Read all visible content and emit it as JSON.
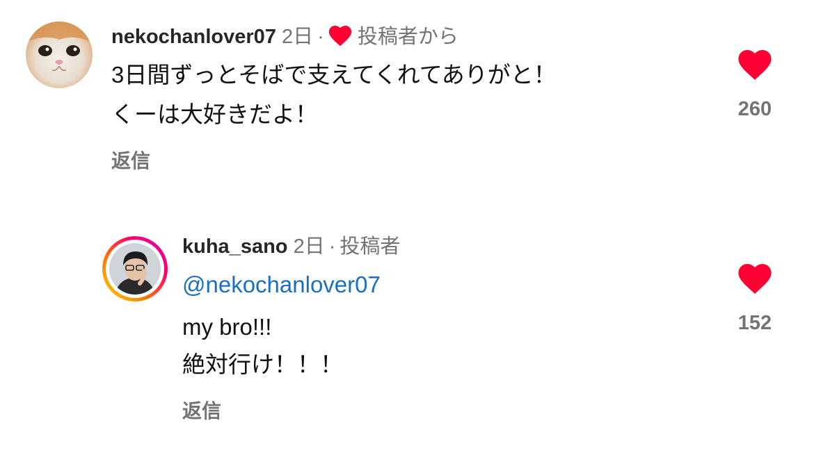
{
  "comments": [
    {
      "username": "nekochanlover07",
      "time": "2日",
      "separator": "·",
      "badge": "投稿者から",
      "badge_heart_icon": "heart-icon",
      "lines": [
        "3日間ずっとそばで支えてくれてありがと！",
        "くーは大好きだよ！"
      ],
      "reply_label": "返信",
      "like_count": "260"
    },
    {
      "username": "kuha_sano",
      "time": "2日",
      "separator": "·",
      "badge": "投稿者",
      "mention": "@nekochanlover07",
      "lines": [
        "my bro!!!",
        "絶対行け！！！"
      ],
      "reply_label": "返信",
      "like_count": "152"
    }
  ],
  "colors": {
    "heart": "#ff0033",
    "mention": "#1a6fc4",
    "muted": "#737373",
    "story_ring_start": "#ff0069",
    "story_ring_end": "#ffd600"
  }
}
